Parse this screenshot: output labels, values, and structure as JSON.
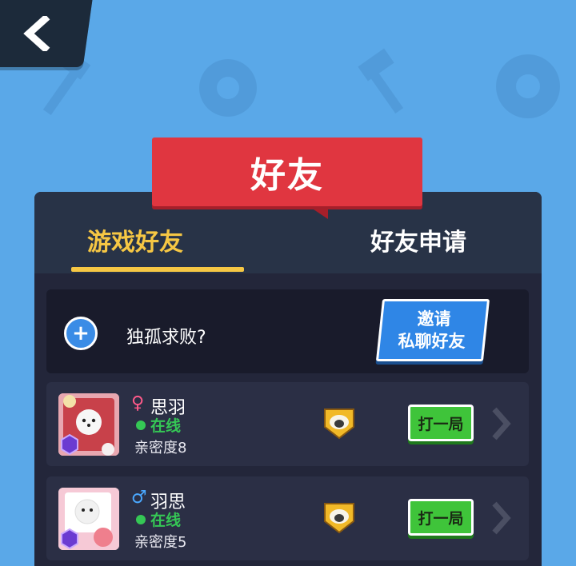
{
  "header": {
    "title": "好友"
  },
  "tabs": [
    {
      "label": "游戏好友",
      "active": true
    },
    {
      "label": "好友申请",
      "active": false
    }
  ],
  "invite": {
    "prompt": "独孤求败?",
    "button_line1": "邀请",
    "button_line2": "私聊好友"
  },
  "friends": [
    {
      "gender": "♀",
      "name": "思羽",
      "status": "在线",
      "intimacy": "亲密度8",
      "play_label": "打一局"
    },
    {
      "gender": "♂",
      "name": "羽思",
      "status": "在线",
      "intimacy": "亲密度5",
      "play_label": "打一局"
    }
  ],
  "colors": {
    "background": "#5aa8e8",
    "banner": "#e03640",
    "active_tab": "#f6c744",
    "online": "#35c755",
    "play_button": "#3fc43a",
    "invite_button": "#2f86e6"
  },
  "icons": {
    "back": "back-arrow-icon",
    "plus": "plus-icon",
    "rank": "sheep-rank-badge-icon",
    "chevron": "chevron-right-icon"
  }
}
